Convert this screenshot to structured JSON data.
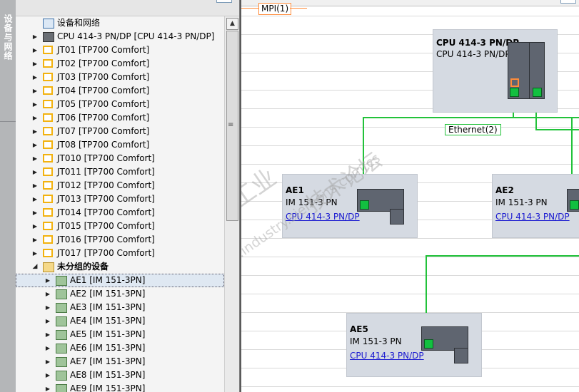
{
  "sidebar_tab": {
    "label": "设备与网络"
  },
  "tree": {
    "root": {
      "label": "设备和网络",
      "icon": "network-icon"
    },
    "stations": [
      {
        "label": "CPU 414-3 PN/DP [CPU 414-3 PN/DP]",
        "icon": "cpu-icon"
      },
      {
        "label": "JT01 [TP700 Comfort]",
        "icon": "hmi-icon"
      },
      {
        "label": "JT02 [TP700 Comfort]",
        "icon": "hmi-icon"
      },
      {
        "label": "JT03 [TP700 Comfort]",
        "icon": "hmi-icon"
      },
      {
        "label": "JT04 [TP700 Comfort]",
        "icon": "hmi-icon"
      },
      {
        "label": "JT05 [TP700 Comfort]",
        "icon": "hmi-icon"
      },
      {
        "label": "JT06 [TP700 Comfort]",
        "icon": "hmi-icon"
      },
      {
        "label": "JT07 [TP700 Comfort]",
        "icon": "hmi-icon"
      },
      {
        "label": "JT08 [TP700 Comfort]",
        "icon": "hmi-icon"
      },
      {
        "label": "JT010 [TP700 Comfort]",
        "icon": "hmi-icon"
      },
      {
        "label": "JT011 [TP700 Comfort]",
        "icon": "hmi-icon"
      },
      {
        "label": "JT012 [TP700 Comfort]",
        "icon": "hmi-icon"
      },
      {
        "label": "JT013 [TP700 Comfort]",
        "icon": "hmi-icon"
      },
      {
        "label": "JT014 [TP700 Comfort]",
        "icon": "hmi-icon"
      },
      {
        "label": "JT015 [TP700 Comfort]",
        "icon": "hmi-icon"
      },
      {
        "label": "JT016 [TP700 Comfort]",
        "icon": "hmi-icon"
      },
      {
        "label": "JT017 [TP700 Comfort]",
        "icon": "hmi-icon"
      }
    ],
    "group": {
      "label": "未分组的设备",
      "icon": "ungrouped-devices-icon"
    },
    "group_items": [
      {
        "label": "AE1 [IM 151-3PN]",
        "icon": "io-device-icon",
        "selected": true
      },
      {
        "label": "AE2 [IM 151-3PN]",
        "icon": "io-device-icon"
      },
      {
        "label": "AE3 [IM 151-3PN]",
        "icon": "io-device-icon"
      },
      {
        "label": "AE4 [IM 151-3PN]",
        "icon": "io-device-icon"
      },
      {
        "label": "AE5 [IM 151-3PN]",
        "icon": "io-device-icon"
      },
      {
        "label": "AE6 [IM 151-3PN]",
        "icon": "io-device-icon"
      },
      {
        "label": "AE7 [IM 151-3PN]",
        "icon": "io-device-icon"
      },
      {
        "label": "AE8 [IM 151-3PN]",
        "icon": "io-device-icon"
      },
      {
        "label": "AE9 [IM 151-3PN]",
        "icon": "io-device-icon"
      }
    ]
  },
  "network_view": {
    "mpi_label": "MPI(1)",
    "ethernet_label": "Ethernet(2)",
    "cpu": {
      "name": "CPU 414-3 PN/DP",
      "type": "CPU 414-3 PN/DP"
    },
    "devices": [
      {
        "name": "AE1",
        "type": "IM 151-3 PN",
        "link": "CPU 414-3 PN/DP"
      },
      {
        "name": "AE2",
        "type": "IM 151-3 PN",
        "link": "CPU 414-3 PN/DP"
      },
      {
        "name": "AE5",
        "type": "IM 151-3 PN",
        "link": "CPU 414-3 PN/DP"
      }
    ],
    "watermark": {
      "line1": "西门子工业",
      "line2": "技术论坛",
      "line3": "support.industry.siemens.com/cs"
    }
  },
  "colors": {
    "ethernet": "#22c23a",
    "mpi": "#ff8c3a",
    "device_bg": "#d5dae2",
    "hyperlink": "#1a1ad0"
  }
}
